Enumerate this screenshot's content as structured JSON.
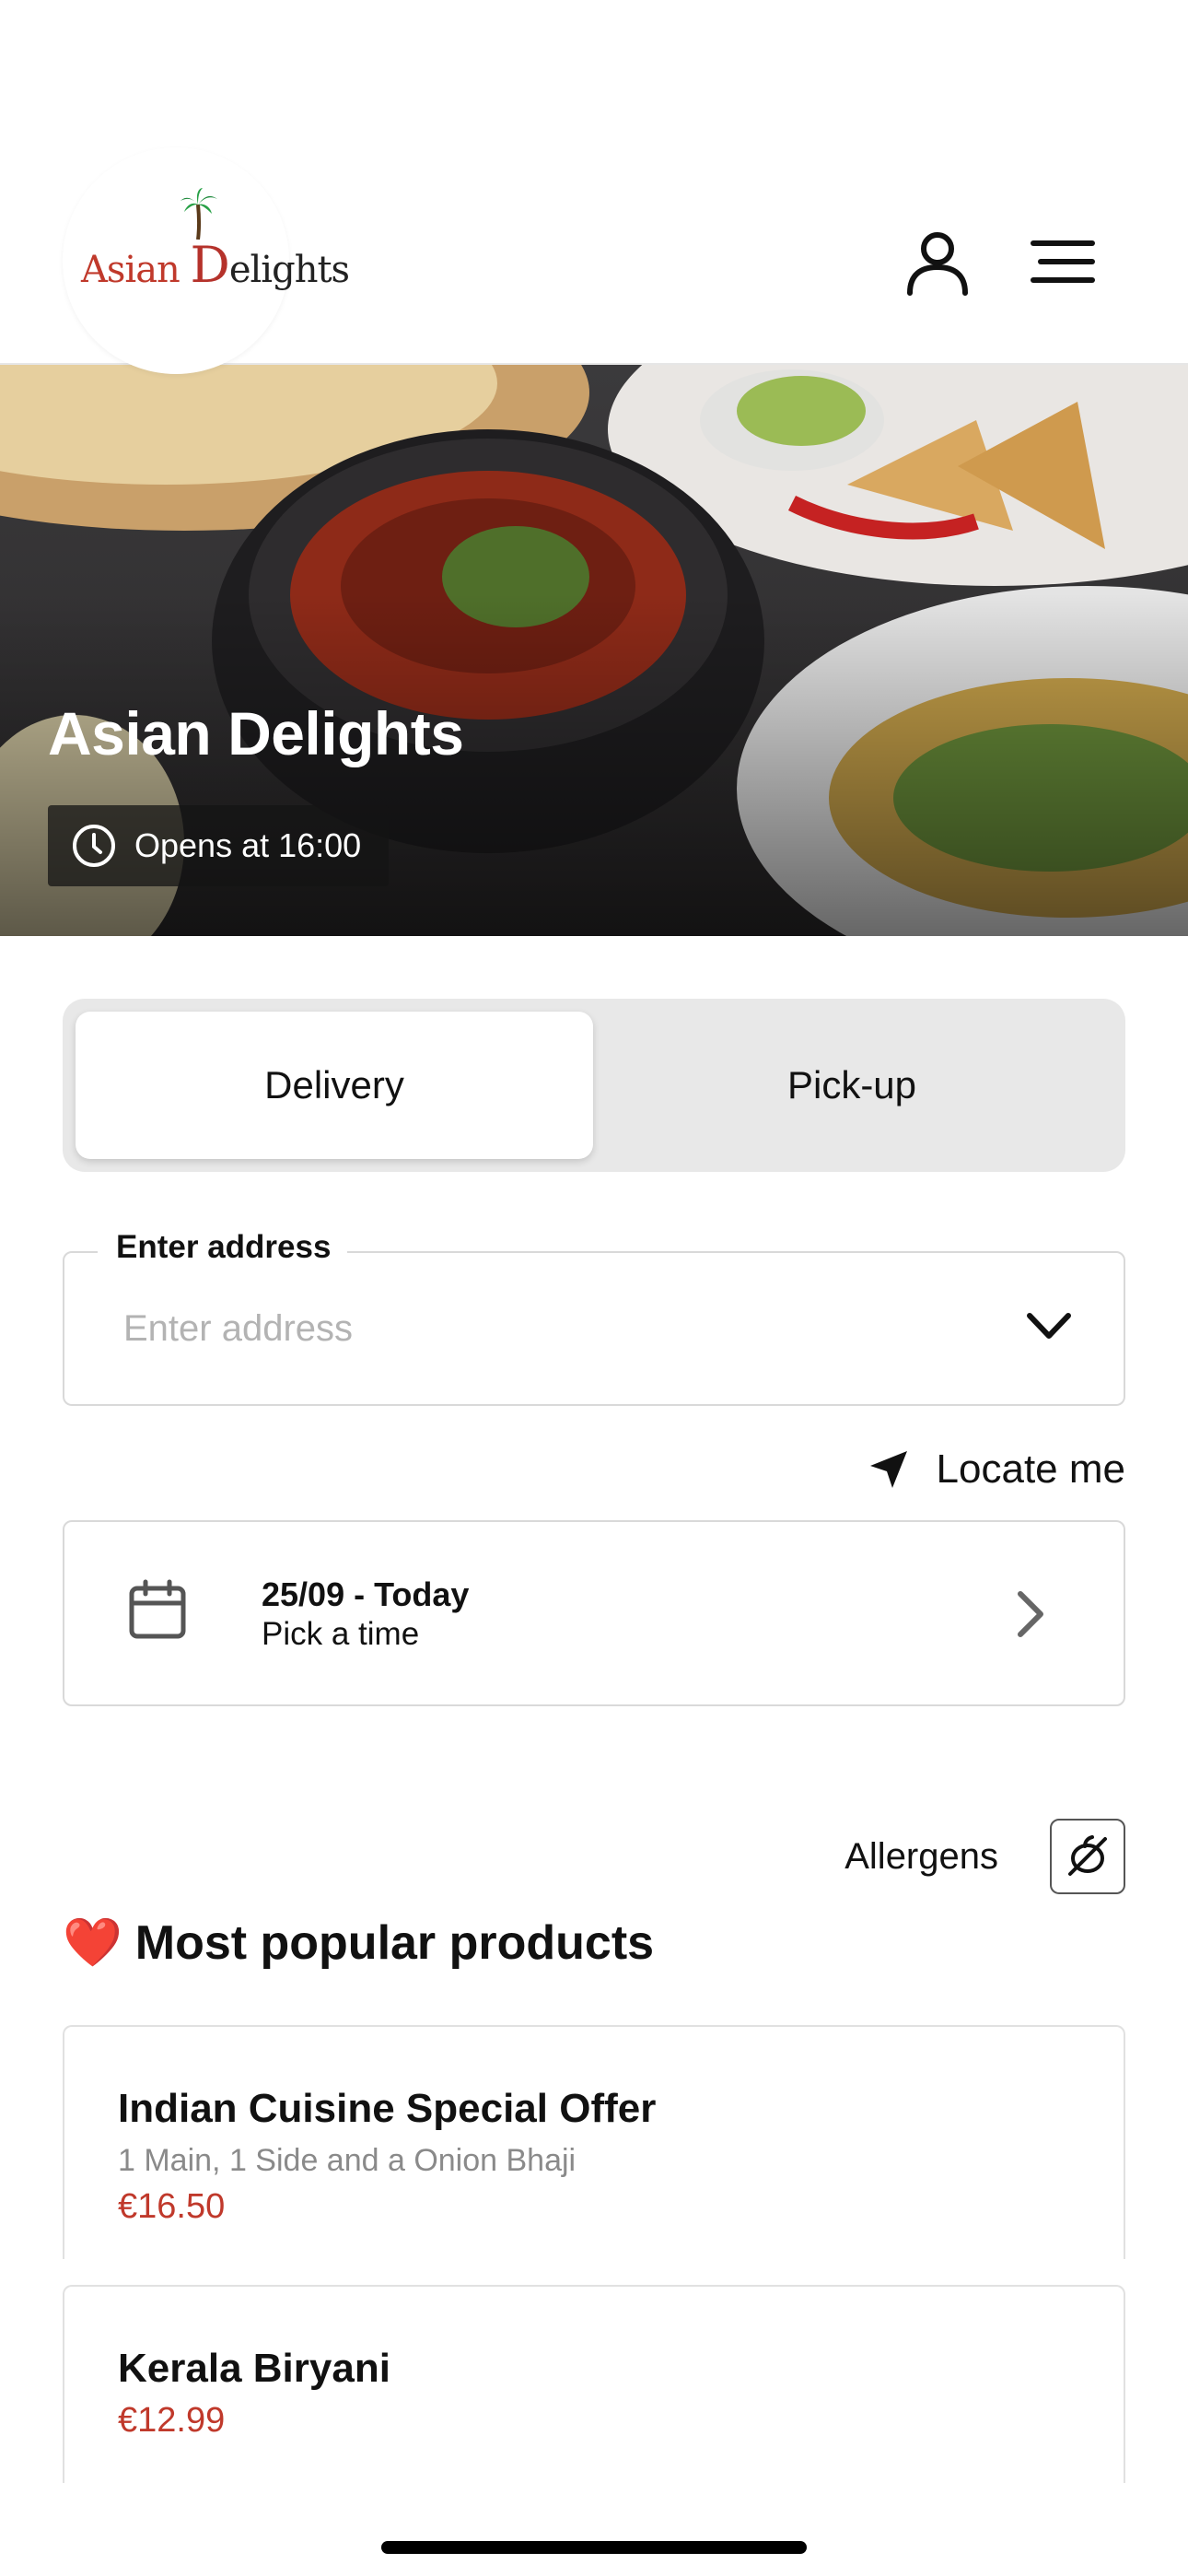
{
  "header": {
    "logo_text_a": "Asian ",
    "logo_text_d": "D",
    "logo_text_rest": "elights"
  },
  "hero": {
    "title": "Asian Delights",
    "hours": "Opens at 16:00"
  },
  "order_mode": {
    "options": [
      "Delivery",
      "Pick-up"
    ],
    "selected": "Delivery"
  },
  "address": {
    "label": "Enter address",
    "placeholder": "Enter address",
    "value": ""
  },
  "locate_label": "Locate me",
  "schedule": {
    "date": "25/09 - Today",
    "time_prompt": "Pick a time"
  },
  "allergens_label": "Allergens",
  "popular": {
    "emoji": "❤️",
    "title": "Most popular products",
    "products": [
      {
        "name": "Indian Cuisine Special Offer",
        "description": "1 Main, 1 Side and a Onion Bhaji",
        "price": "€16.50"
      },
      {
        "name": "Kerala Biryani",
        "price": "€12.99"
      }
    ]
  },
  "colors": {
    "price": "#c0392b",
    "toggle_bg": "#e8e8e8",
    "border": "#d9d9d9"
  },
  "icons": [
    "user-icon",
    "menu-icon",
    "clock-icon",
    "chevron-down-icon",
    "location-arrow-icon",
    "calendar-icon",
    "chevron-right-icon",
    "allergen-icon"
  ]
}
